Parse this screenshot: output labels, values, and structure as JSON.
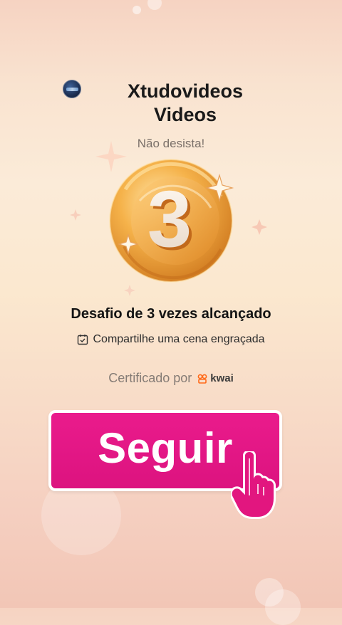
{
  "header": {
    "title_line1": "Xtudovideos",
    "title_line2": "Videos",
    "subtitle": "Não desista!"
  },
  "medal": {
    "number": "3",
    "colors": {
      "gold_light": "#ffd891",
      "gold": "#f1a53d",
      "gold_dark": "#c96f19",
      "number_fill": "#f8efe6"
    }
  },
  "achievement": {
    "headline": "Desafio de 3 vezes alcançado",
    "challenge_text": "Compartilhe uma cena engraçada"
  },
  "certification": {
    "label": "Certificado por",
    "brand": "kwai"
  },
  "cta": {
    "label": "Seguir",
    "color": "#e2167f"
  },
  "icons": {
    "avatar": "channel-avatar",
    "calendar": "calendar-check-icon",
    "brand": "kwai-logo-icon",
    "cursor": "hand-pointer-icon"
  }
}
